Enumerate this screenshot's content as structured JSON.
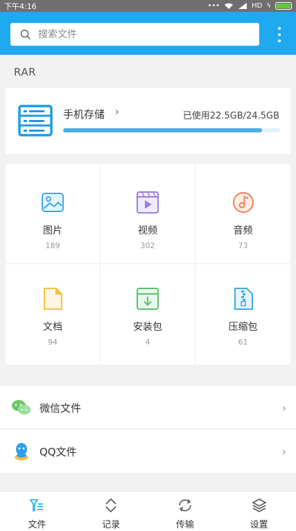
{
  "status_bar": {
    "time": "下午4:16",
    "network": "HD"
  },
  "search": {
    "placeholder": "搜索文件"
  },
  "section_label": "RAR",
  "storage": {
    "title": "手机存储",
    "chevron": "›",
    "usage": "已使用22.5GB/24.5GB",
    "used_fraction": 0.918
  },
  "categories": [
    {
      "label": "图片",
      "count": "189",
      "icon": "image-icon",
      "color": "#3fa8e8"
    },
    {
      "label": "视频",
      "count": "302",
      "icon": "video-icon",
      "color": "#9b7fe0"
    },
    {
      "label": "音频",
      "count": "73",
      "icon": "music-icon",
      "color": "#f27f59"
    },
    {
      "label": "文档",
      "count": "94",
      "icon": "document-icon",
      "color": "#f5c242"
    },
    {
      "label": "安装包",
      "count": "4",
      "icon": "package-icon",
      "color": "#5cc06e"
    },
    {
      "label": "压缩包",
      "count": "61",
      "icon": "zip-icon",
      "color": "#3fa8e8"
    }
  ],
  "list": [
    {
      "label": "微信文件",
      "icon": "wechat-icon",
      "chevron": "›"
    },
    {
      "label": "QQ文件",
      "icon": "qq-icon",
      "chevron": "›"
    }
  ],
  "bottom_nav": [
    {
      "label": "文件",
      "icon": "files-icon",
      "active": true
    },
    {
      "label": "记录",
      "icon": "history-icon"
    },
    {
      "label": "传输",
      "icon": "transfer-icon"
    },
    {
      "label": "设置",
      "icon": "settings-layers-icon"
    }
  ],
  "colors": {
    "primary": "#1ea9f1",
    "progress": "#4aaee8"
  }
}
